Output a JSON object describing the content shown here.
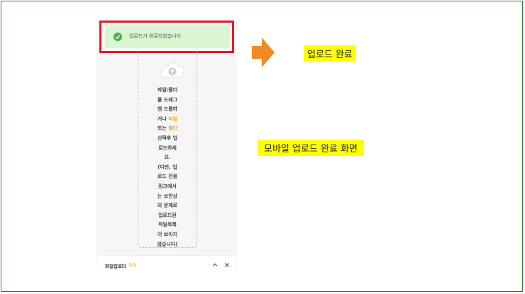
{
  "toast": {
    "message": "업로드가 완료되었습니다.",
    "color": "#d9f5d2"
  },
  "dropzone": {
    "line1": "파일/폴더\n를 드래그\n앤 드롭하\n거나 ",
    "file_link": "파일",
    "line2": "\n또는 ",
    "folder_link": "폴더",
    "line3": "\n선택후 업\n로드하세\n요.\n(다만, 업\n로드 전용\n링크에서\n는 보안상\n의 문제로\n업로드된\n파일목록\n이 보이지\n않습니다)"
  },
  "bottom_bar": {
    "label": "파일업로더",
    "count": "1/1"
  },
  "annotations": {
    "upload_complete": "업로드 완료",
    "mobile_screen": "모바일 업로드 완료 화면"
  },
  "colors": {
    "accent": "#f5a623",
    "highlight": "#e01b24",
    "arrow": "#f08a24",
    "label_bg": "#ffff00",
    "frame": "#2e7d32"
  }
}
